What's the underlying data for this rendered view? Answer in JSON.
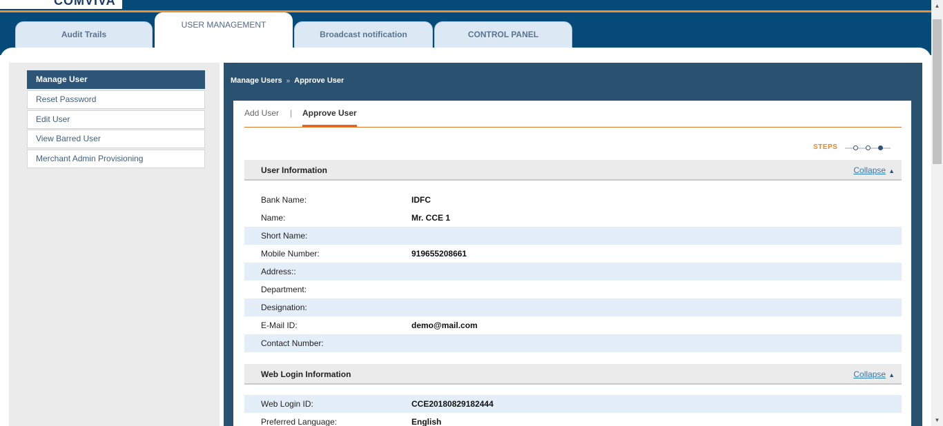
{
  "header": {
    "logo_text": "COMVIVA",
    "tabs": [
      {
        "label": "Audit Trails"
      },
      {
        "label": "USER MANAGEMENT"
      },
      {
        "label": "Broadcast notification"
      },
      {
        "label": "CONTROL PANEL"
      }
    ]
  },
  "sidebar": {
    "items": [
      {
        "label": "Manage User"
      },
      {
        "label": "Reset Password"
      },
      {
        "label": "Edit User"
      },
      {
        "label": "View Barred User"
      },
      {
        "label": "Merchant Admin Provisioning"
      }
    ]
  },
  "breadcrumb": {
    "parent": "Manage Users",
    "separator": "»",
    "current": "Approve User"
  },
  "subtabs": {
    "add": "Add User",
    "divider": "|",
    "approve": "Approve User"
  },
  "steps": {
    "label": "STEPS",
    "total": 3,
    "current": 3
  },
  "user_info": {
    "title": "User Information",
    "collapse": "Collapse",
    "collapse_icon": "triangle-up-icon",
    "fields": [
      {
        "key": "Bank Name:",
        "value": "IDFC"
      },
      {
        "key": "Name:",
        "value": "Mr. CCE 1"
      },
      {
        "key": "Short Name:",
        "value": ""
      },
      {
        "key": "Mobile Number:",
        "value": "919655208661"
      },
      {
        "key": "Address::",
        "value": ""
      },
      {
        "key": "Department:",
        "value": ""
      },
      {
        "key": "Designation:",
        "value": ""
      },
      {
        "key": "E-Mail ID:",
        "value": "demo@mail.com"
      },
      {
        "key": "Contact Number:",
        "value": ""
      }
    ]
  },
  "web_login": {
    "title": "Web Login Information",
    "collapse": "Collapse",
    "fields": [
      {
        "key": "Web Login ID:",
        "value": "CCE20180829182444"
      },
      {
        "key": "Preferred Language:",
        "value": "English"
      }
    ]
  },
  "colors": {
    "header_bg": "#064a7a",
    "accent_orange": "#f0902a",
    "panel_bg": "#2b5171",
    "row_alt": "#e3eef9"
  }
}
